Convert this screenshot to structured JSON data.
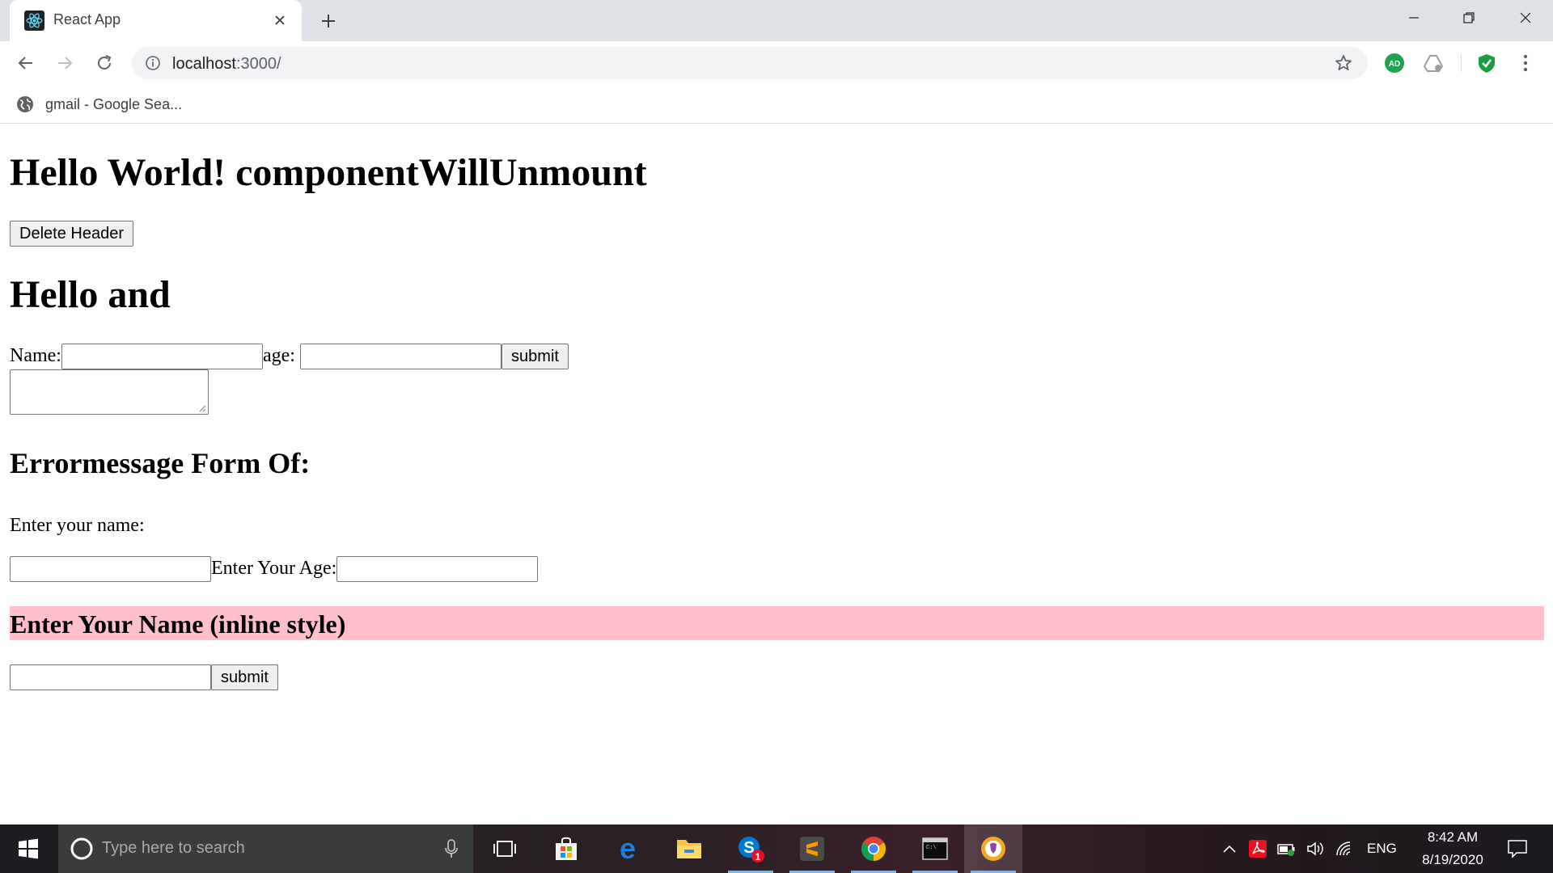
{
  "browser": {
    "tab_title": "React App",
    "url_host": "localhost",
    "url_path": ":3000/",
    "bookmark_label": "gmail - Google Sea...",
    "extensions": [
      "adguard-icon",
      "drive-icon",
      "shield-check-icon"
    ],
    "accent_colors": {
      "adguard": "#1fa152",
      "shield": "#1a9e3f",
      "tabstrip": "#dee1e6"
    }
  },
  "page": {
    "heading_main": "Hello World! componentWillUnmount",
    "delete_button": "Delete Header",
    "heading_hello": "Hello and",
    "form1": {
      "name_label": "Name:",
      "name_value": "",
      "age_label": "age:",
      "age_value": "",
      "submit_label": "submit",
      "textarea_value": ""
    },
    "heading_error": "Errormessage Form Of:",
    "form2": {
      "enter_name_label": "Enter your name:",
      "name_value": "",
      "enter_age_label": "Enter Your Age:",
      "age_value": ""
    },
    "inline_heading": "Enter Your Name (inline style)",
    "inline_heading_bg": "#ffc0cb",
    "form3": {
      "input_value": "",
      "submit_label": "submit"
    }
  },
  "taskbar": {
    "search_placeholder": "Type here to search",
    "apps": [
      "task-view-icon",
      "store-icon",
      "edge-icon",
      "file-explorer-icon",
      "skype-icon",
      "sublime-text-icon",
      "chrome-icon",
      "terminal-icon",
      "brave-icon"
    ],
    "skype_badge": "1",
    "language": "ENG",
    "time": "8:42 AM",
    "date": "8/19/2020"
  }
}
